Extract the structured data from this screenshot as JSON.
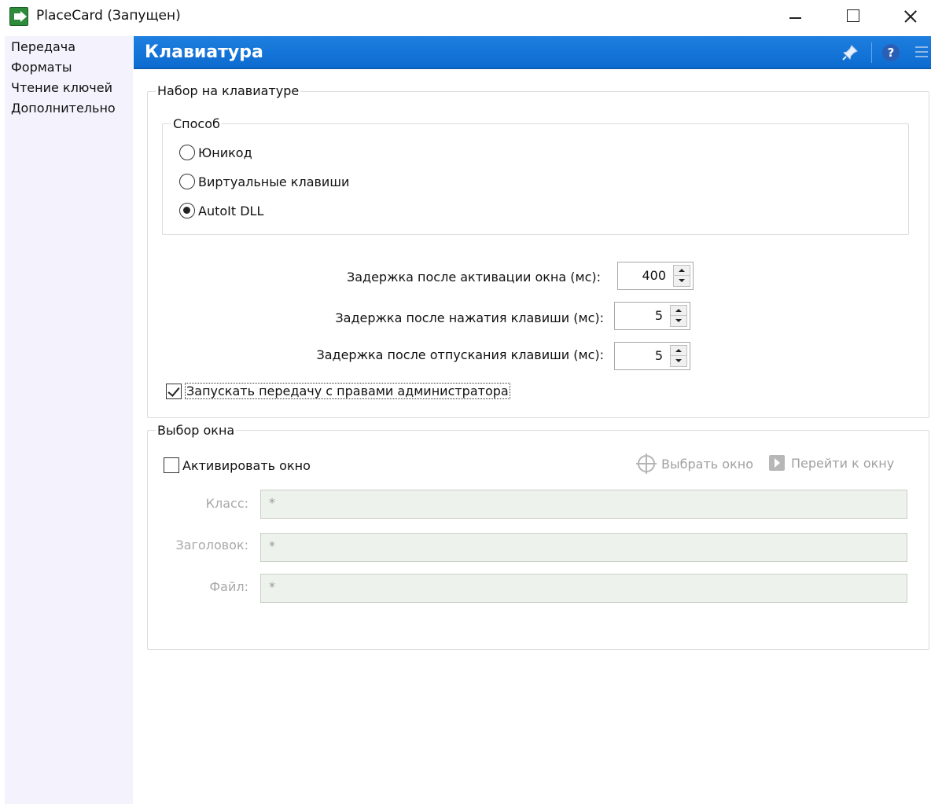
{
  "window": {
    "title": "PlaceCard (Запущен)"
  },
  "sidebar": {
    "items": [
      {
        "label": "Передача"
      },
      {
        "label": "Форматы"
      },
      {
        "label": "Чтение ключей"
      },
      {
        "label": "Дополнительно"
      }
    ]
  },
  "header": {
    "title": "Клавиатура",
    "icons": [
      "pin-icon",
      "help-icon",
      "menu-icon"
    ],
    "color": "#0d6bd0"
  },
  "keyboard_group": {
    "legend": "Набор на клавиатуре",
    "method_group": {
      "legend": "Способ",
      "options": [
        {
          "label": "Юникод",
          "checked": false
        },
        {
          "label": "Виртуальные клавиши",
          "checked": false
        },
        {
          "label": "AutoIt DLL",
          "checked": true
        }
      ]
    },
    "delays": [
      {
        "label": "Задержка после активации окна (мс):",
        "value": "400"
      },
      {
        "label": "Задержка после нажатия клавиши (мс):",
        "value": "5"
      },
      {
        "label": "Задержка после отпускания клавиши (мс):",
        "value": "5"
      }
    ],
    "admin_checkbox": {
      "label": "Запускать передачу с правами администратора",
      "checked": true
    }
  },
  "window_group": {
    "legend": "Выбор окна",
    "activate_checkbox": {
      "label": "Активировать окно",
      "checked": false
    },
    "select_window_button": "Выбрать окно",
    "goto_window_button": "Перейти к окну",
    "fields": [
      {
        "label": "Класс:",
        "value": "*"
      },
      {
        "label": "Заголовок:",
        "value": "*"
      },
      {
        "label": "Файл:",
        "value": "*"
      }
    ]
  }
}
